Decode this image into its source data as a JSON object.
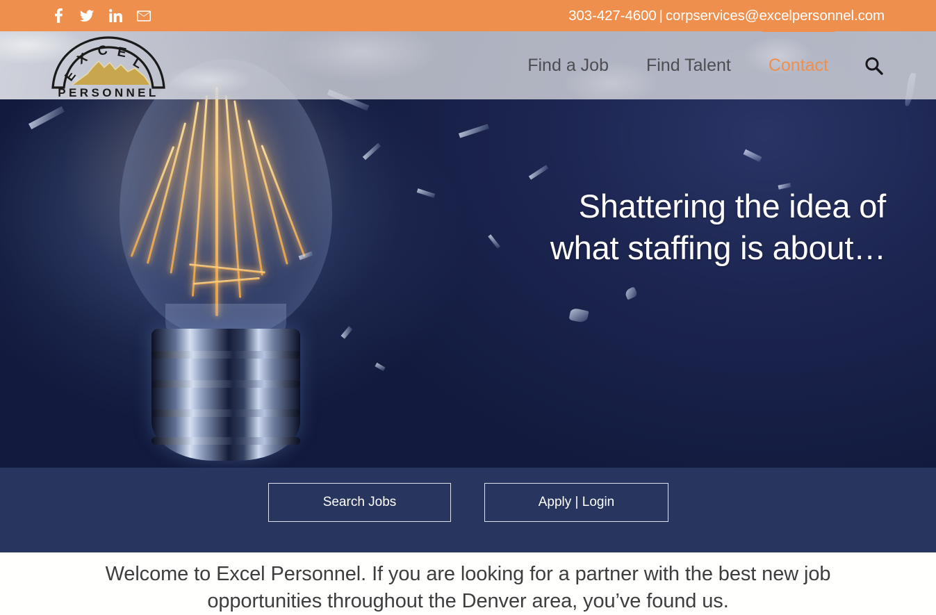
{
  "topbar": {
    "social": [
      {
        "name": "facebook-icon",
        "label": "Facebook"
      },
      {
        "name": "twitter-icon",
        "label": "Twitter"
      },
      {
        "name": "linkedin-icon",
        "label": "LinkedIn"
      },
      {
        "name": "email-icon",
        "label": "Email"
      }
    ],
    "phone": "303-427-4600",
    "separator": "|",
    "email": "corpservices@excelpersonnel.com",
    "background_color": "#ef8f4d"
  },
  "header": {
    "logo": {
      "arc_text": "EXCEL",
      "arc_letters": [
        "E",
        "X",
        "C",
        "E",
        "L"
      ],
      "wordmark": "PERSONNEL",
      "icon_name": "excel-personnel-logo"
    },
    "nav": [
      {
        "label": "Find a Job",
        "active": false
      },
      {
        "label": "Find Talent",
        "active": false
      },
      {
        "label": "Contact",
        "active": true
      }
    ],
    "search_icon": "search-icon",
    "accent_color": "#ef8f4d",
    "nav_text_color": "#4d4d52"
  },
  "hero": {
    "headline_line1": "Shattering the idea of",
    "headline_line2": "what staffing is about…",
    "image_alt": "shattering-light-bulb",
    "background_color": "#1c2550"
  },
  "cta": {
    "search_jobs_label": "Search Jobs",
    "apply_login_label": "Apply | Login",
    "background_color": "#27355f"
  },
  "welcome": {
    "text": "Welcome to Excel Personnel. If you are looking for a partner with the best new job opportunities throughout the Denver area, you’ve found us.",
    "text_color": "#3d3d3f"
  }
}
